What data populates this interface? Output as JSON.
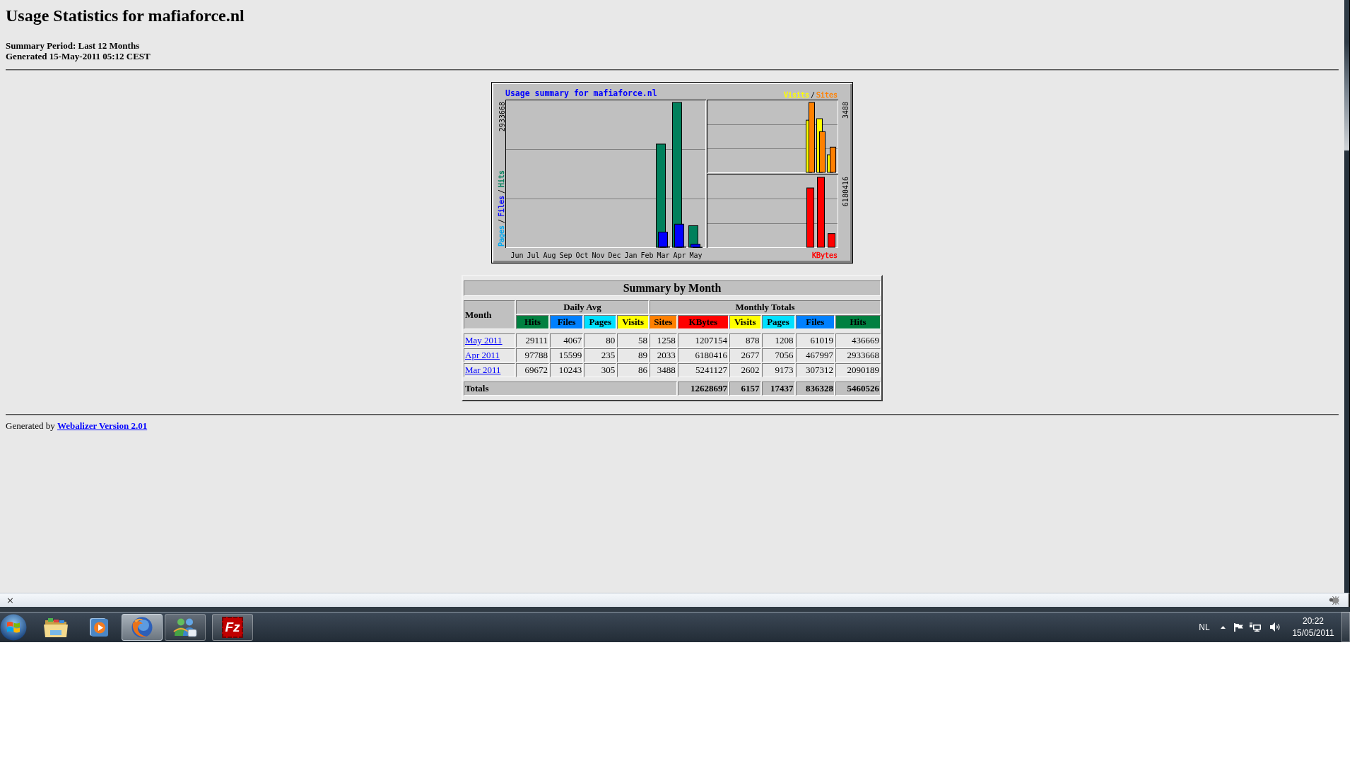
{
  "page": {
    "title": "Usage Statistics for mafiaforce.nl",
    "summary_period": "Summary Period: Last 12 Months",
    "generated": "Generated 15-May-2011 05:12 CEST",
    "usage_graph": {
      "title": "Usage summary for mafiaforce.nl",
      "legend_separator": "/",
      "panels": [
        {
          "scale_label": "2933668",
          "months": [
            "Jun",
            "Jul",
            "Aug",
            "Sep",
            "Oct",
            "Nov",
            "Dec",
            "Jan",
            "Feb",
            "Mar",
            "Apr",
            "May"
          ],
          "legend": [
            {
              "label": "Hits",
              "color": "#00805c"
            },
            {
              "label": "Files",
              "color": "#0000ff"
            },
            {
              "label": "Pages",
              "color": "#00a8f0"
            }
          ]
        },
        {
          "scale_label": "3488",
          "legend": [
            {
              "label": "Visits",
              "color": "#ffff00"
            },
            {
              "label": "Sites",
              "color": "#ff8000"
            }
          ]
        },
        {
          "scale_label": "6180416",
          "legend": [
            {
              "label": "KBytes",
              "color": "#ff0000"
            }
          ]
        }
      ]
    },
    "summary_table": {
      "title": "Summary by Month",
      "month_header": "Month",
      "groups": [
        {
          "label": "Daily Avg",
          "columns": [
            {
              "label": "Hits",
              "color": "#008040"
            },
            {
              "label": "Files",
              "color": "#0080ff"
            },
            {
              "label": "Pages",
              "color": "#00e0ff"
            },
            {
              "label": "Visits",
              "color": "#ffff00"
            }
          ]
        },
        {
          "label": "Monthly Totals",
          "columns": [
            {
              "label": "Sites",
              "color": "#ff8000"
            },
            {
              "label": "KBytes",
              "color": "#ff0000"
            },
            {
              "label": "Visits",
              "color": "#ffff00"
            },
            {
              "label": "Pages",
              "color": "#00e0ff"
            },
            {
              "label": "Files",
              "color": "#0080ff"
            },
            {
              "label": "Hits",
              "color": "#008040"
            }
          ]
        }
      ],
      "rows": [
        {
          "month": "May 2011",
          "values": [
            "29111",
            "4067",
            "80",
            "58",
            "1258",
            "1207154",
            "878",
            "1208",
            "61019",
            "436669"
          ]
        },
        {
          "month": "Apr 2011",
          "values": [
            "97788",
            "15599",
            "235",
            "89",
            "2033",
            "6180416",
            "2677",
            "7056",
            "467997",
            "2933668"
          ]
        },
        {
          "month": "Mar 2011",
          "values": [
            "69672",
            "10243",
            "305",
            "86",
            "3488",
            "5241127",
            "2602",
            "9173",
            "307312",
            "2090189"
          ]
        }
      ],
      "totals": {
        "label": "Totals",
        "values": [
          "12628697",
          "6157",
          "17437",
          "836328",
          "5460526"
        ]
      }
    },
    "footer": {
      "text": "Generated by",
      "link": "Webalizer Version 2.01"
    }
  },
  "status_bar": {
    "close": "×"
  },
  "taskbar": {
    "apps": [
      {
        "kind": "folder",
        "running": false,
        "selected": false
      },
      {
        "kind": "player",
        "running": false,
        "selected": false
      },
      {
        "kind": "browser",
        "running": true,
        "selected": true
      },
      {
        "kind": "messenger",
        "running": true,
        "selected": false
      },
      {
        "kind": "ftp",
        "running": true,
        "selected": false,
        "glyph": "Fz"
      }
    ],
    "language": "NL",
    "clock": {
      "time": "20:22",
      "date": "15/05/2011"
    }
  }
}
